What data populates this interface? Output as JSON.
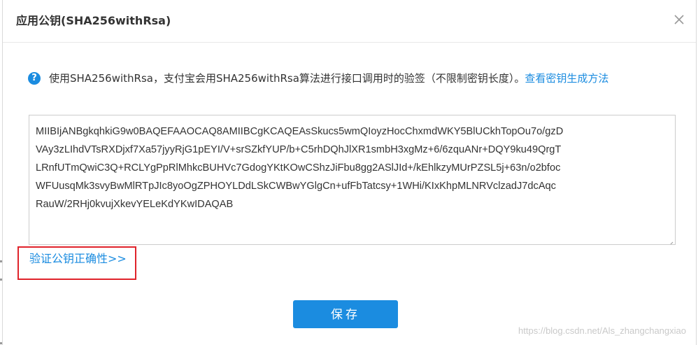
{
  "dialog": {
    "title": "应用公钥(SHA256withRsa)",
    "close_icon": "close-icon"
  },
  "hint": {
    "icon": "question-icon",
    "icon_glyph": "?",
    "text": "使用SHA256withRsa，支付宝会用SHA256withRsa算法进行接口调用时的验签（不限制密钥长度）。",
    "link_label": "查看密钥生成方法"
  },
  "public_key": {
    "lines": [
      "MIIBIjANBgkqhkiG9w0BAQEFAAOCAQ8AMIIBCgKCAQEAsSkucs5wmQIoyzHocChxmdWKY5BlUCkhTopOu7o/gzD",
      "VAy3zLIhdVTsRXDjxf7Xa57jyyRjG1pEYI/V+srSZkfYUP/b+C5rhDQhJlXR1smbH3xgMz+6/6zquANr+DQY9ku49QrgT",
      "LRnfUTmQwiC3Q+RCLYgPpRlMhkcBUHVc7GdogYKtKOwCShzJiFbu8gg2ASlJId+/kEhlkzyMUrPZSL5j+63n/o2bfoc",
      "WFUusqMk3svyBwMlRTpJIc8yoOgZPHOYLDdLSkCWBwYGlgCn+ufFbTatcsy+1WHi/KIxKhpMLNRVclzadJ7dcAqc",
      "RauW/2RHj0kvujXkevYELeKdYKwIDAQAB"
    ]
  },
  "verify": {
    "label": "验证公钥正确性>>"
  },
  "actions": {
    "save_label": "保存"
  },
  "watermark": "https://blog.csdn.net/Als_zhangchangxiao",
  "colors": {
    "accent": "#1b8ce0",
    "highlight_frame": "#e0232b"
  }
}
